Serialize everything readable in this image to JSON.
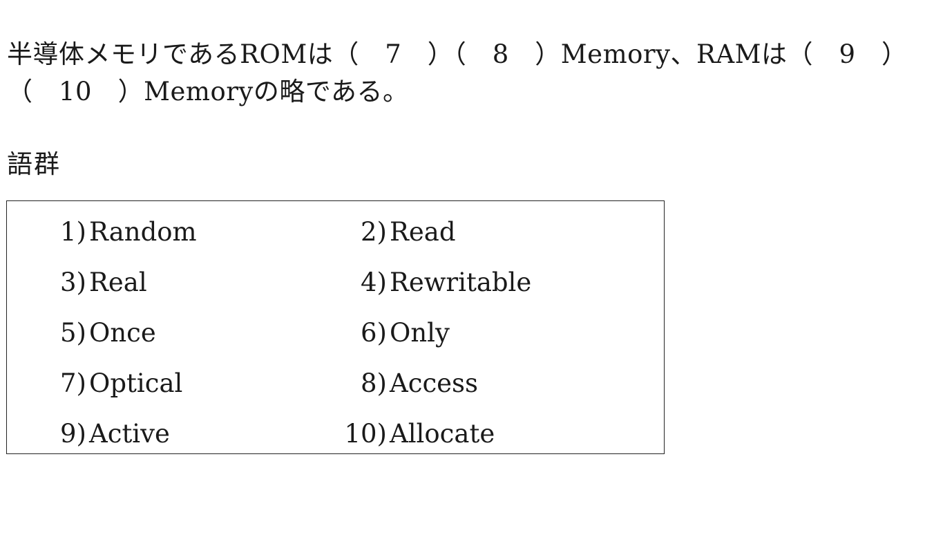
{
  "question": {
    "line1": "半導体メモリであるROMは（　7　）（　8　）Memory、RAMは（　9　）",
    "line2": "（　10　）Memoryの略である。"
  },
  "word_bank": {
    "heading": "語群",
    "items": [
      {
        "num": "1)",
        "word": "Random"
      },
      {
        "num": "2)",
        "word": "Read"
      },
      {
        "num": "3)",
        "word": "Real"
      },
      {
        "num": "4)",
        "word": "Rewritable"
      },
      {
        "num": "5)",
        "word": "Once"
      },
      {
        "num": "6)",
        "word": "Only"
      },
      {
        "num": "7)",
        "word": "Optical"
      },
      {
        "num": "8)",
        "word": "Access"
      },
      {
        "num": "9)",
        "word": "Active"
      },
      {
        "num": "10)",
        "word": "Allocate"
      }
    ]
  }
}
